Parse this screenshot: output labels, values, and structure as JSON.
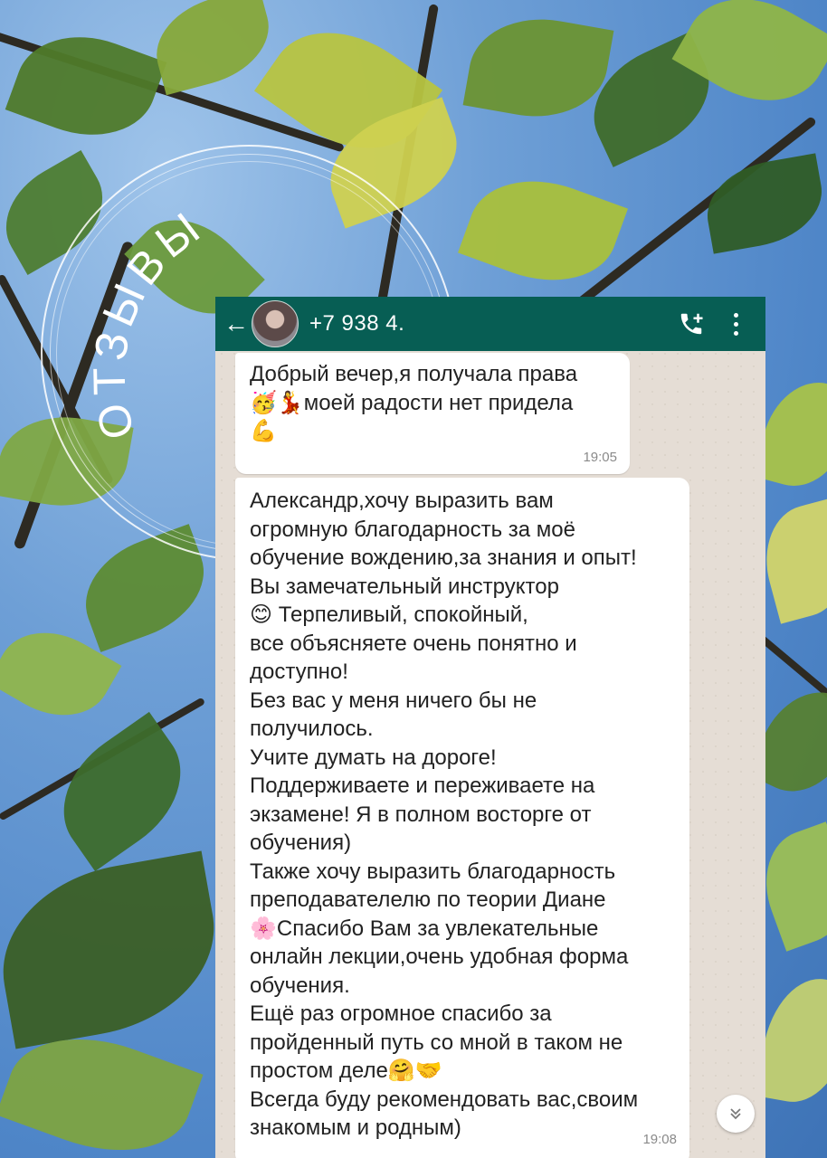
{
  "overlay": {
    "title": "ОТЗЫВЫ"
  },
  "chat": {
    "contact_name": "+7 938 4.",
    "icons": {
      "back": "arrow-left-icon",
      "call": "add-call-icon",
      "more": "more-vert-icon",
      "scroll": "double-chevron-down-icon"
    },
    "colors": {
      "app_bar": "#075e54",
      "chat_bg": "#e5ddd5",
      "bubble": "#ffffff"
    },
    "messages": [
      {
        "text": "Добрый вечер,я получала права\n🥳💃моей радости нет придела\n💪",
        "time": "19:05"
      },
      {
        "text": "Александр,хочу выразить вам\nогромную благодарность за моё\nобучение вождению,за знания и опыт!\nВы замечательный инструктор\n😊 Терпеливый, спокойный,\nвсе объясняете очень понятно и\nдоступно!\nБез вас у меня ничего бы не\nполучилось.\nУчите думать на дороге!\nПоддерживаете и переживаете на\nэкзамене! Я в полном восторге от\nобучения)\nТакже хочу выразить благодарность\nпреподавателелю по теории Диане\n🌸Спасибо Вам за увлекательные\nонлайн  лекции,очень удобная форма\nобучения.\nЕщё раз огромное спасибо за\nпройденный путь со мной в таком не\nпростом деле🤗🤝\nВсегда буду рекомендовать вас,своим\nзнакомым и родным)",
        "time": "19:08"
      }
    ]
  }
}
